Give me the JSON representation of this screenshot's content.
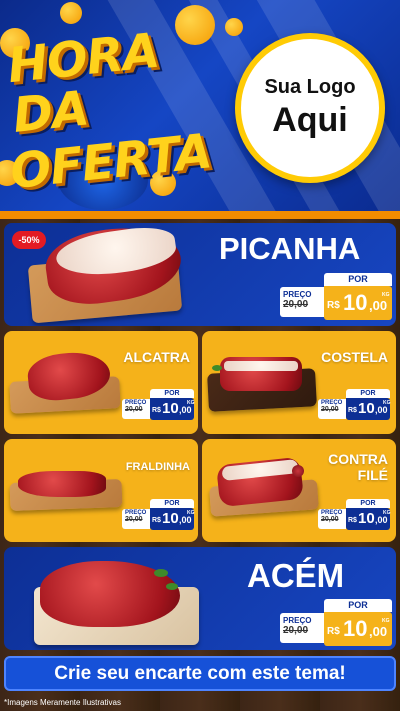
{
  "header": {
    "title_line1": "HORA DA",
    "title_line2": "OFERTA",
    "logo_line1": "Sua Logo",
    "logo_line2": "Aqui"
  },
  "colors": {
    "blue": "#0d2f95",
    "yellow": "#f5b21a",
    "orange": "#f28c00",
    "red": "#e31b23"
  },
  "currency": "R$",
  "products": {
    "picanha": {
      "name": "PICANHA",
      "badge": "-50%",
      "por": "POR",
      "preco_label": "PREÇO",
      "old": "20,00",
      "new_int": "10",
      "new_dec": ",00",
      "unit": "KG"
    },
    "alcatra": {
      "name": "ALCATRA",
      "por": "POR",
      "preco_label": "PREÇO",
      "old": "20,00",
      "new_int": "10",
      "new_dec": ",00",
      "unit": "KG"
    },
    "costela": {
      "name": "COSTELA",
      "por": "POR",
      "preco_label": "PREÇO",
      "old": "20,00",
      "new_int": "10",
      "new_dec": ",00",
      "unit": "KG"
    },
    "fraldinha": {
      "name": "FRALDINHA",
      "por": "POR",
      "preco_label": "PREÇO",
      "old": "20,00",
      "new_int": "10",
      "new_dec": ",00",
      "unit": "KG"
    },
    "contra_file": {
      "name_line1": "CONTRA",
      "name_line2": "FILÉ",
      "por": "POR",
      "preco_label": "PREÇO",
      "old": "20,00",
      "new_int": "10",
      "new_dec": ",00",
      "unit": "KG"
    },
    "acem": {
      "name": "ACÉM",
      "por": "POR",
      "preco_label": "PREÇO",
      "old": "20,00",
      "new_int": "10",
      "new_dec": ",00",
      "unit": "KG"
    }
  },
  "cta": "Crie seu encarte com este tema!",
  "footnote": "*Imagens Meramente Ilustrativas"
}
